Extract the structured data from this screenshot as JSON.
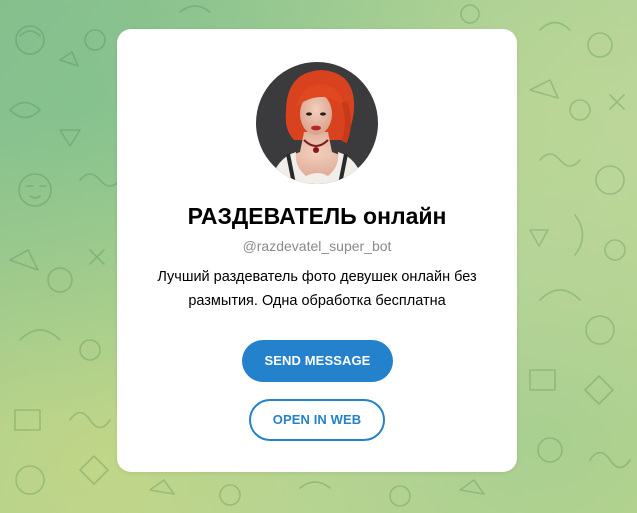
{
  "profile": {
    "title": "РАЗДЕВАТЕЛЬ онлайн",
    "username": "@razdevatel_super_bot",
    "description": "Лучший раздеватель фото девушек онлайн без размытия. Одна обработка бесплатна"
  },
  "actions": {
    "send_message_label": "SEND MESSAGE",
    "open_in_web_label": "OPEN IN WEB"
  },
  "colors": {
    "accent": "#2481cc",
    "username": "#8a8a8a",
    "card_background": "#ffffff"
  },
  "icons": {
    "avatar": "bot-avatar-image",
    "background": "doodle-pattern"
  }
}
